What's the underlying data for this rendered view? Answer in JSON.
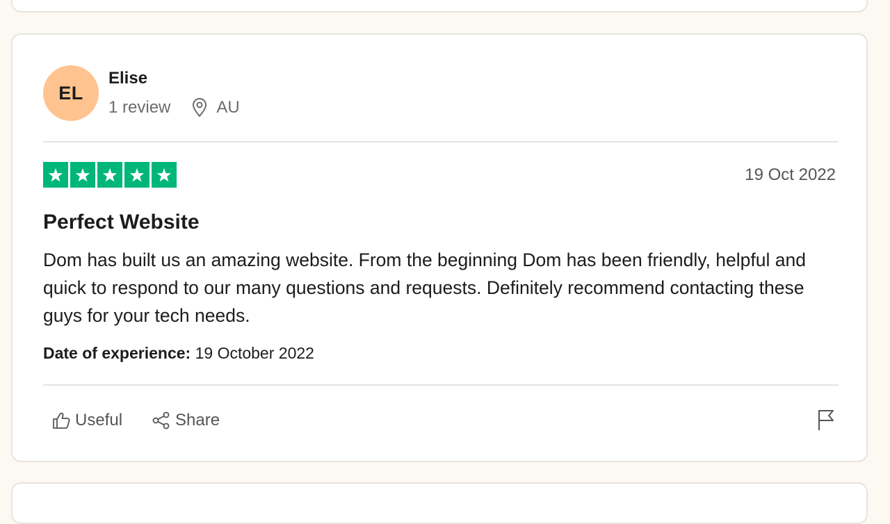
{
  "review": {
    "avatar_initials": "EL",
    "user_name": "Elise",
    "review_count": "1 review",
    "location": "AU",
    "rating": 5,
    "date": "19 Oct 2022",
    "title": "Perfect Website",
    "body": "Dom has built us an amazing website. From the beginning Dom has been friendly, helpful and quick to respond to our many questions and requests. Definitely recommend contacting these guys for your tech needs.",
    "experience_label": "Date of experience:",
    "experience_date": "19 October 2022"
  },
  "actions": {
    "useful_label": "Useful",
    "share_label": "Share"
  },
  "colors": {
    "star_green": "#00b67a",
    "avatar_bg": "#ffc38f",
    "page_bg": "#fcf9f3"
  },
  "icons": [
    "location-pin-icon",
    "star-icon",
    "thumbs-up-icon",
    "share-icon",
    "flag-icon"
  ]
}
